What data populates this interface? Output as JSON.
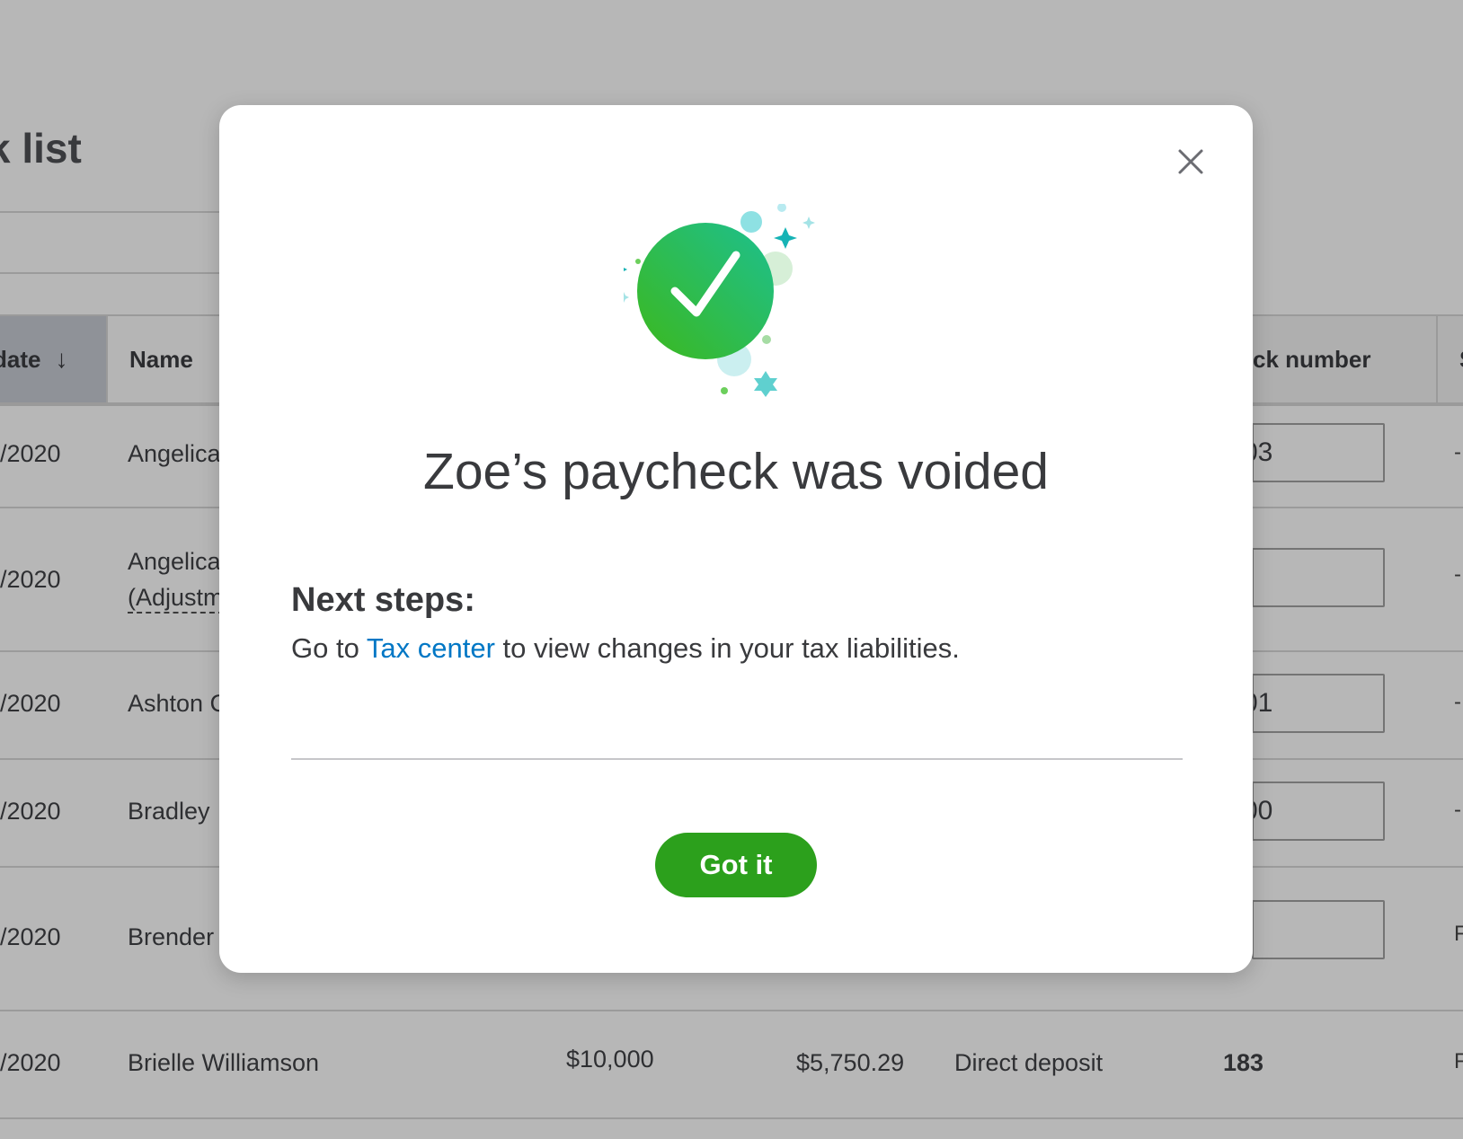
{
  "page": {
    "title": "k list"
  },
  "table": {
    "columns": {
      "date": "date",
      "name": "Name",
      "check_number": "ck number",
      "status": "S"
    },
    "rows": [
      {
        "date": "/2020",
        "name": "Angelica",
        "check": "03",
        "side": "-"
      },
      {
        "date": "/2020",
        "name_line1": "Angelica",
        "name_line2": "(Adjustm",
        "check": "",
        "side": "-"
      },
      {
        "date": "/2020",
        "name": "Ashton C",
        "check": "01",
        "side": "-"
      },
      {
        "date": "/2020",
        "name": "Bradley",
        "check": "00",
        "side": "-"
      },
      {
        "date": "/2020",
        "name": "Brender",
        "check": "",
        "side": "F"
      },
      {
        "date": "/2020",
        "name": "Brielle Williamson",
        "amount": "$10,000",
        "net": "$5,750.29",
        "method": "Direct deposit",
        "check": "183",
        "side": "F"
      }
    ]
  },
  "modal": {
    "title": "Zoe’s paycheck was voided",
    "next_steps_heading": "Next steps:",
    "next_steps_prefix": "Go to ",
    "next_steps_link": "Tax center",
    "next_steps_suffix": " to view changes in your tax liabilities.",
    "button_label": "Got it",
    "close_icon": "close-icon",
    "hero_icon": "check-circle-icon"
  },
  "colors": {
    "primary_green": "#2ca01c",
    "link_blue": "#0077c5",
    "backdrop": "#b7b7b7"
  }
}
